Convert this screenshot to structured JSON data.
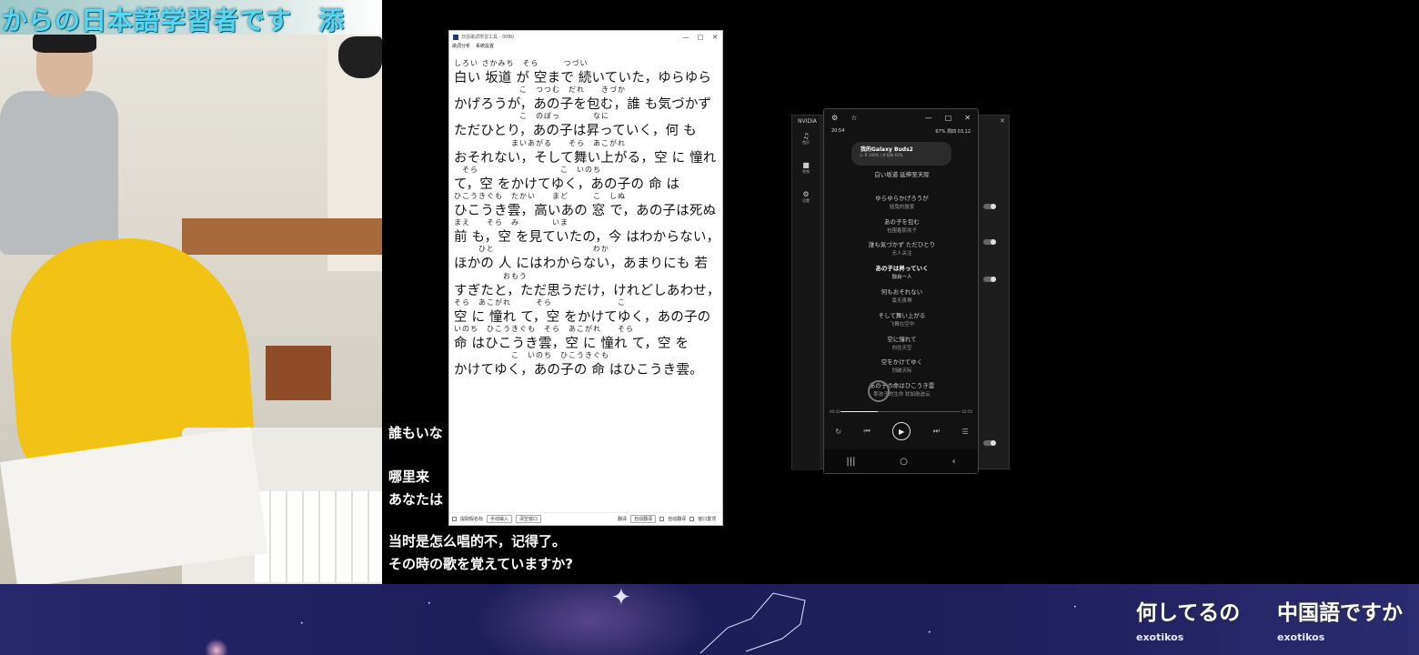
{
  "stream_banner": "からの日本語学習者です　添",
  "lyric_app": {
    "title": "日語歌詞學習工具 - 00B0",
    "menu": [
      "歌詞分析",
      "系統設置"
    ],
    "window_controls": [
      "—",
      "□",
      "✕"
    ],
    "lines": [
      {
        "ruby": "しろい さかみち　そら　　　つづい",
        "text": "白い 坂道 が 空まで 続いていた，ゆらゆら"
      },
      {
        "ruby": "　　　　　　　　こ　つつむ　だれ　　きづか",
        "text": "かげろうが，あの子を包む，誰 も気づかず"
      },
      {
        "ruby": "　　　　　　　　こ　のぼっ　　　　なに",
        "text": "ただひとり，あの子は昇っていく，何 も"
      },
      {
        "ruby": "　　　　　　　まいあがる　　そら　あこがれ",
        "text": "おそれない，そして舞い上がる，空 に 憧れ"
      },
      {
        "ruby": "　そら　　　　　　　　　　こ　いのち",
        "text": "て，空 をかけてゆく，あの子の 命 は"
      },
      {
        "ruby": "ひこうきぐも　たかい　　まど　　　こ　しぬ",
        "text": "ひこうき雲，高いあの 窓 で，あの子は死ぬ"
      },
      {
        "ruby": "まえ　　そら　み　　　　いま",
        "text": "前 も，空 を見ていたの，今 はわからない，"
      },
      {
        "ruby": "　　　ひと　　　　　　　　　　　　わか",
        "text": "ほかの 人 にはわからない，あまりにも 若"
      },
      {
        "ruby": "　　　　　　おもう",
        "text": "すぎたと，ただ思うだけ，けれどしあわせ，"
      },
      {
        "ruby": "そら　あこがれ　　　そら　　　　　　　　こ",
        "text": "空 に 憧れ て，空 をかけてゆく，あの子の"
      },
      {
        "ruby": "いのち　ひこうきぐも　そら　あこがれ　　そら",
        "text": "命 はひこうき雲，空 に 憧れ て，空 を"
      },
      {
        "ruby": "　　　　　　　こ　いのち　ひこうきぐも",
        "text": "かけてゆく，あの子の 命 はひこうき雲。"
      }
    ],
    "footer": {
      "checkbox_left": "提取假名标",
      "btn1": "手动输入",
      "btn2": "清空窗口",
      "label_translate": "翻译",
      "select_value": "自动翻译",
      "chk_auto": "自动翻译",
      "chk_pin": "窗口置顶"
    }
  },
  "subtitles": {
    "partial1": "誰もいな",
    "partial2": "哪里来",
    "partial3": "あなたは",
    "line_cn": "当时是怎么唱的不，记得了。",
    "line_jp": "その時の歌を覚えていますか?"
  },
  "nvidia": {
    "title": "NVIDIA",
    "side_items": [
      {
        "icon": "headphones-icon",
        "label": "首页"
      },
      {
        "icon": "camera-icon",
        "label": "视频"
      },
      {
        "icon": "gear-icon",
        "label": "设置"
      }
    ]
  },
  "phone": {
    "time": "20:54",
    "battery": "67%",
    "date": "周四 03.12",
    "buds_name": "我的Galaxy Buds2",
    "buds_info": "L: R 100% | 外包装 63%",
    "lyrics": [
      {
        "jp": "白い坂道 延伸至天际",
        "cn": ""
      },
      {
        "jp": "ゆらゆらかげろうが",
        "cn": "摇曳的蜃景"
      },
      {
        "jp": "あの子を包む",
        "cn": "包围着那孩子"
      },
      {
        "jp": "誰も気づかず ただひとり",
        "cn": "无人关注"
      },
      {
        "jp": "あの子は昇っていく",
        "cn": "独自一人",
        "active": true
      },
      {
        "jp": "何もおそれない",
        "cn": "毫无畏惧"
      },
      {
        "jp": "そして舞い上がる",
        "cn": "飞舞在空中"
      },
      {
        "jp": "空に憧れて",
        "cn": "向往天空"
      },
      {
        "jp": "空をかけてゆく",
        "cn": "划破天际"
      },
      {
        "jp": "あの子の命はひこうき雲",
        "cn": "那孩子的生命 犹如航迹云"
      }
    ],
    "time_elapsed": "00:42",
    "time_total": "03:50",
    "progress": 0.31
  },
  "chat": [
    {
      "message": "何してるの",
      "user": "exotikos"
    },
    {
      "message": "中国語ですか",
      "user": "exotikos"
    }
  ],
  "colors": {
    "kanji_highlight": "#c9eef7",
    "particle_orange": "#f0922b",
    "subtitle_cyan": "#5ad7f0"
  }
}
